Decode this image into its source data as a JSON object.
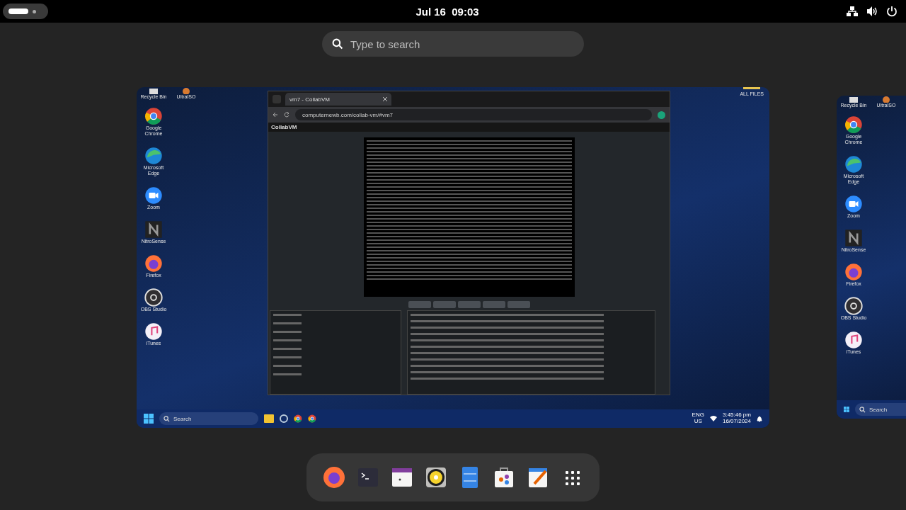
{
  "top_bar": {
    "clock": "Jul 16  09:03"
  },
  "search": {
    "placeholder": "Type to search"
  },
  "workspace": {
    "desktop_icons": [
      {
        "label": "Google Chrome"
      },
      {
        "label": "Microsoft Edge"
      },
      {
        "label": "Zoom"
      },
      {
        "label": "NitroSense"
      },
      {
        "label": "Firefox"
      },
      {
        "label": "OBS Studio"
      },
      {
        "label": "iTunes"
      }
    ],
    "top_icons": [
      {
        "label": "Recycle Bin"
      },
      {
        "label": "UltraISO"
      }
    ],
    "corner_icon": {
      "label": "ALL FILES"
    },
    "browser": {
      "tab": "vm7 - CollabVM",
      "url": "computernewb.com/collab-vm/#vm7",
      "site_title": "CollabVM"
    },
    "taskbar": {
      "search": "Search",
      "language": "ENG",
      "region": "US",
      "time": "3:45:46 pm",
      "date": "16/07/2024"
    }
  },
  "next_workspace": {
    "top_icons": [
      {
        "label": "Recycle Bin"
      },
      {
        "label": "UltraISO"
      }
    ],
    "desktop_icons": [
      {
        "label": "Google Chrome"
      },
      {
        "label": "Microsoft Edge"
      },
      {
        "label": "Zoom"
      },
      {
        "label": "NitroSense"
      },
      {
        "label": "Firefox"
      },
      {
        "label": "OBS Studio"
      },
      {
        "label": "iTunes"
      }
    ],
    "taskbar": {
      "search": "Search"
    }
  }
}
